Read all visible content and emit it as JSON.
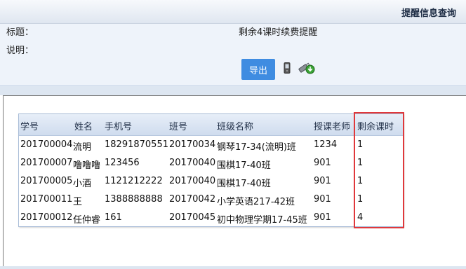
{
  "header": {
    "title": "提醒信息查询"
  },
  "form": {
    "title_label": "标题：",
    "title_value": "剩余4课时续费提醒",
    "desc_label": "说明：",
    "desc_value": ""
  },
  "toolbar": {
    "export_label": "导出",
    "phone_icon": "phone-icon",
    "usb_icon": "usb-download-icon"
  },
  "table": {
    "columns": [
      "学号",
      "姓名",
      "手机号",
      "班号",
      "班级名称",
      "授课老师",
      "剩余课时"
    ],
    "rows": [
      [
        "201700004",
        "流明",
        "18291870551",
        "20170034",
        "钢琴17-34(流明)班",
        "1234",
        "1"
      ],
      [
        "201700007",
        "噜噜噜",
        "123456",
        "20170040",
        "围棋17-40班",
        "901",
        "1"
      ],
      [
        "201700005",
        "小酒",
        "1121212222",
        "20170040",
        "围棋17-40班",
        "901",
        "1"
      ],
      [
        "201700011",
        "王",
        "1388888888",
        "20170042",
        "小学英语217-42班",
        "901",
        "1"
      ],
      [
        "201700012",
        "任仲睿",
        "161",
        "20170045",
        "初中物理学期17-45班",
        "901",
        "4"
      ]
    ]
  },
  "colors": {
    "accent": "#3f8ce1",
    "highlight": "#e0383b",
    "panel": "#eef3fa"
  }
}
